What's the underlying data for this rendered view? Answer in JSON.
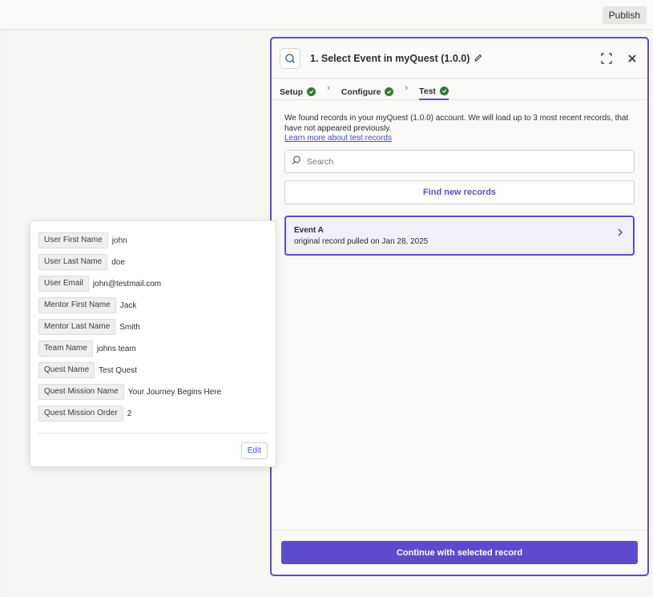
{
  "topbar": {
    "publish_label": "Publish"
  },
  "panel": {
    "title": "1. Select Event in myQuest (1.0.0)",
    "tabs": [
      {
        "label": "Setup"
      },
      {
        "label": "Configure"
      },
      {
        "label": "Test"
      }
    ],
    "description": "We found records in your myQuest (1.0.0) account. We will load up to 3 most recent records, that have not appeared previously.",
    "learn_link": "Learn more about test records",
    "search_placeholder": "Search",
    "find_button": "Find new records",
    "record": {
      "title": "Event A",
      "subtitle": "original record pulled on Jan 28, 2025"
    },
    "continue_button": "Continue with selected record"
  },
  "record_fields": [
    {
      "key": "User First Name",
      "value": "john"
    },
    {
      "key": "User Last Name",
      "value": "doe"
    },
    {
      "key": "User Email",
      "value": "john@testmail.com"
    },
    {
      "key": "Mentor First Name",
      "value": "Jack"
    },
    {
      "key": "Mentor Last Name",
      "value": "Smith"
    },
    {
      "key": "Team Name",
      "value": "johns team"
    },
    {
      "key": "Quest Name",
      "value": "Test Quest"
    },
    {
      "key": "Quest Mission Name",
      "value": "Your Journey Begins Here"
    },
    {
      "key": "Quest Mission Order",
      "value": "2"
    }
  ],
  "popover": {
    "edit_label": "Edit"
  },
  "colors": {
    "accent": "#5b4ccf",
    "success": "#2e7d32",
    "link": "#3b4fd6"
  },
  "icons": [
    "app-icon",
    "pencil-icon",
    "expand-icon",
    "close-icon",
    "check-circle-icon",
    "chevron-right-icon",
    "search-icon"
  ]
}
